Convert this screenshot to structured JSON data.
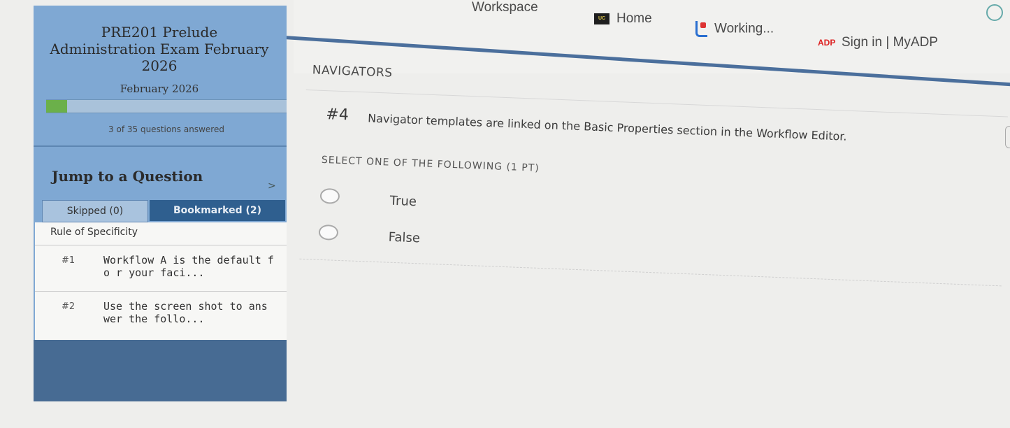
{
  "bookmarks": {
    "workspace": "Workspace",
    "home": "Home",
    "home_icon": "UC",
    "working": "Working...",
    "adp": "Sign in | MyADP",
    "adp_icon": "ADP"
  },
  "sidebar": {
    "exam_title": "PRE201 Prelude Administration Exam February 2026",
    "exam_subtitle": "February 2026",
    "progress_fraction": 0.086,
    "answered": "3 of 35 questions answered",
    "jump_label": "Jump to a Question",
    "tabs": {
      "skipped": "Skipped (0)",
      "bookmarked": "Bookmarked (2)"
    },
    "group_title": "Rule of Specificity",
    "questions": [
      {
        "number": "#1",
        "text": "Workflow A is the default fo r your faci..."
      },
      {
        "number": "#2",
        "text": "Use the screen shot to ans wer the follo..."
      }
    ]
  },
  "main": {
    "section": "NAVIGATORS",
    "question_number": "#4",
    "question_text": "Navigator templates are linked on the Basic Properties section in the Workflow Editor.",
    "instructions": "SELECT ONE OF THE FOLLOWING (1 PT)",
    "options": [
      "True",
      "False"
    ]
  }
}
